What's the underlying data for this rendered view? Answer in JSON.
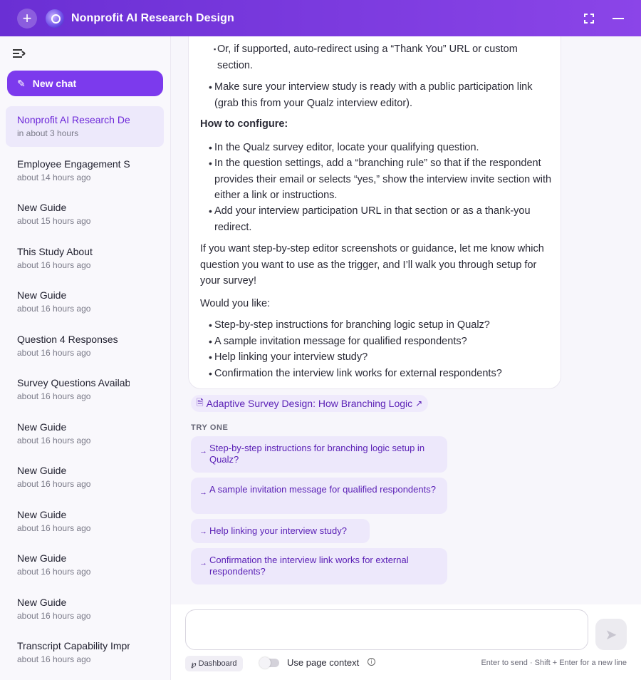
{
  "header": {
    "title": "Nonprofit AI Research Design",
    "plus_icon": "+"
  },
  "sidebar": {
    "new_chat_label": "New chat",
    "chats": [
      {
        "title": "Nonprofit AI Research Design",
        "time": "in about 3 hours",
        "active": true
      },
      {
        "title": "Employee Engagement Survey",
        "time": "about 14 hours ago"
      },
      {
        "title": "New Guide",
        "time": "about 15 hours ago"
      },
      {
        "title": "This Study About",
        "time": "about 16 hours ago"
      },
      {
        "title": "New Guide",
        "time": "about 16 hours ago"
      },
      {
        "title": "Question 4 Responses",
        "time": "about 16 hours ago"
      },
      {
        "title": "Survey Questions Available",
        "time": "about 16 hours ago"
      },
      {
        "title": "New Guide",
        "time": "about 16 hours ago"
      },
      {
        "title": "New Guide",
        "time": "about 16 hours ago"
      },
      {
        "title": "New Guide",
        "time": "about 16 hours ago"
      },
      {
        "title": "New Guide",
        "time": "about 16 hours ago"
      },
      {
        "title": "New Guide",
        "time": "about 16 hours ago"
      },
      {
        "title": "Transcript Capability Improvement",
        "time": "about 16 hours ago"
      }
    ]
  },
  "message": {
    "sub_bullet": "Or, if supported, auto-redirect using a “Thank You” URL or custom section.",
    "bullet_ready": "Make sure your interview study is ready with a public participation link (grab this from your Qualz interview editor).",
    "how_heading": "How to configure:",
    "config_bullets": [
      "In the Qualz survey editor, locate your qualifying question.",
      "In the question settings, add a “branching rule” so that if the respondent provides their email or selects “yes,” show the interview invite section with either a link or instructions.",
      "Add your interview participation URL in that section or as a thank-you redirect."
    ],
    "follow_up": "If you want step-by-step editor screenshots or guidance, let me know which question you want to use as the trigger, and I’ll walk you through setup for your survey!",
    "would_you_like": "Would you like:",
    "options": [
      "Step-by-step instructions for branching logic setup in Qualz?",
      "A sample invitation message for qualified respondents?",
      "Help linking your interview study?",
      "Confirmation the interview link works for external respondents?"
    ]
  },
  "source": {
    "label": "Adaptive Survey Design: How Branching Logic"
  },
  "try_one": {
    "label": "TRY ONE",
    "suggestions": [
      "Step-by-step instructions for branching logic setup in Qualz?",
      "A sample invitation message for qualified respondents?",
      "Help linking your interview study?",
      "Confirmation the interview link works for external respondents?"
    ]
  },
  "composer": {
    "placeholder": "",
    "dashboard_label": "Dashboard",
    "context_label": "Use page context",
    "hint": "Enter to send · Shift + Enter for a new line"
  },
  "icons": {
    "plus": "plus-icon",
    "logo": "logo-icon",
    "expand": "expand-icon",
    "minimize": "minimize-icon",
    "collapse": "sidebar-collapse-icon",
    "pencil": "pencil-icon",
    "send": "send-icon"
  },
  "colors": {
    "accent": "#7c3aed",
    "header_start": "#6a2fd4",
    "header_end": "#8b45e8"
  }
}
